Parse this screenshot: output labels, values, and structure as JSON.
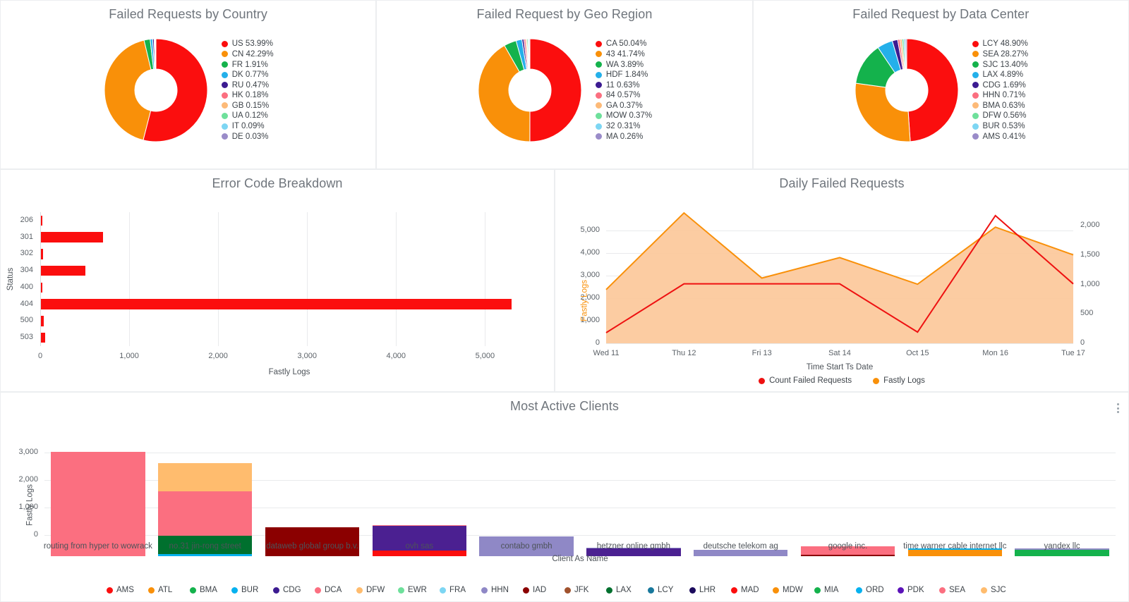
{
  "palette": {
    "red": "#fb0e0e",
    "orange": "#f99009",
    "green": "#14b24c",
    "blue": "#24b0ea",
    "darkpurple": "#3c1b91",
    "pink": "#fb6f80",
    "lightorange": "#fdba78",
    "lightgreen": "#6ee09b",
    "skyblue": "#7dd6f3",
    "lightpurple": "#9a8cc9",
    "panel_bg": "#ffffff",
    "page_bg": "#f4f5f7",
    "title_gray": "#6f757c"
  },
  "donuts": [
    {
      "title": "Failed Requests by Country",
      "slices": [
        {
          "label": "US",
          "pct": 53.99,
          "text": "US 53.99%",
          "color": "#fb0e0e"
        },
        {
          "label": "CN",
          "pct": 42.29,
          "text": "CN 42.29%",
          "color": "#f99009"
        },
        {
          "label": "FR",
          "pct": 1.91,
          "text": "FR 1.91%",
          "color": "#14b24c"
        },
        {
          "label": "DK",
          "pct": 0.77,
          "text": "DK 0.77%",
          "color": "#24b0ea"
        },
        {
          "label": "RU",
          "pct": 0.47,
          "text": "RU 0.47%",
          "color": "#3c1b91"
        },
        {
          "label": "HK",
          "pct": 0.18,
          "text": "HK 0.18%",
          "color": "#fb6f80"
        },
        {
          "label": "GB",
          "pct": 0.15,
          "text": "GB 0.15%",
          "color": "#fdba78"
        },
        {
          "label": "UA",
          "pct": 0.12,
          "text": "UA 0.12%",
          "color": "#6ee09b"
        },
        {
          "label": "IT",
          "pct": 0.09,
          "text": "IT 0.09%",
          "color": "#7dd6f3"
        },
        {
          "label": "DE",
          "pct": 0.03,
          "text": "DE 0.03%",
          "color": "#9a8cc9"
        }
      ]
    },
    {
      "title": "Failed Request by Geo Region",
      "slices": [
        {
          "label": "CA",
          "pct": 50.04,
          "text": "CA 50.04%",
          "color": "#fb0e0e"
        },
        {
          "label": "43",
          "pct": 41.74,
          "text": "43 41.74%",
          "color": "#f99009"
        },
        {
          "label": "WA",
          "pct": 3.89,
          "text": "WA 3.89%",
          "color": "#14b24c"
        },
        {
          "label": "HDF",
          "pct": 1.84,
          "text": "HDF 1.84%",
          "color": "#24b0ea"
        },
        {
          "label": "11",
          "pct": 0.63,
          "text": "11 0.63%",
          "color": "#3c1b91"
        },
        {
          "label": "84",
          "pct": 0.57,
          "text": "84 0.57%",
          "color": "#fb6f80"
        },
        {
          "label": "GA",
          "pct": 0.37,
          "text": "GA 0.37%",
          "color": "#fdba78"
        },
        {
          "label": "MOW",
          "pct": 0.37,
          "text": "MOW 0.37%",
          "color": "#6ee09b"
        },
        {
          "label": "32",
          "pct": 0.31,
          "text": "32 0.31%",
          "color": "#7dd6f3"
        },
        {
          "label": "MA",
          "pct": 0.26,
          "text": "MA 0.26%",
          "color": "#9a8cc9"
        }
      ]
    },
    {
      "title": "Failed Request by Data Center",
      "slices": [
        {
          "label": "LCY",
          "pct": 48.9,
          "text": "LCY 48.90%",
          "color": "#fb0e0e"
        },
        {
          "label": "SEA",
          "pct": 28.27,
          "text": "SEA 28.27%",
          "color": "#f99009"
        },
        {
          "label": "SJC",
          "pct": 13.4,
          "text": "SJC 13.40%",
          "color": "#14b24c"
        },
        {
          "label": "LAX",
          "pct": 4.89,
          "text": "LAX 4.89%",
          "color": "#24b0ea"
        },
        {
          "label": "CDG",
          "pct": 1.69,
          "text": "CDG 1.69%",
          "color": "#3c1b91"
        },
        {
          "label": "HHN",
          "pct": 0.71,
          "text": "HHN 0.71%",
          "color": "#fb6f80"
        },
        {
          "label": "BMA",
          "pct": 0.63,
          "text": "BMA 0.63%",
          "color": "#fdba78"
        },
        {
          "label": "DFW",
          "pct": 0.56,
          "text": "DFW 0.56%",
          "color": "#6ee09b"
        },
        {
          "label": "BUR",
          "pct": 0.53,
          "text": "BUR 0.53%",
          "color": "#7dd6f3"
        },
        {
          "label": "AMS",
          "pct": 0.41,
          "text": "AMS 0.41%",
          "color": "#9a8cc9"
        }
      ]
    }
  ],
  "error_chart": {
    "title": "Error Code Breakdown"
  },
  "daily_chart": {
    "title": "Daily Failed Requests"
  },
  "clients_chart": {
    "title": "Most Active Clients"
  },
  "chart_data": [
    {
      "type": "bar",
      "orientation": "horizontal",
      "title": "Error Code Breakdown",
      "xlabel": "Fastly Logs",
      "ylabel": "Status",
      "categories": [
        "206",
        "301",
        "302",
        "304",
        "400",
        "404",
        "500",
        "503"
      ],
      "values": [
        8,
        700,
        25,
        500,
        5,
        5290,
        35,
        50
      ],
      "xlim": [
        0,
        5600
      ],
      "xticks": [
        0,
        1000,
        2000,
        3000,
        4000,
        5000
      ],
      "xticklabels": [
        "0",
        "1,000",
        "2,000",
        "3,000",
        "4,000",
        "5,000"
      ],
      "color": "#fb0e0e",
      "grid": true
    },
    {
      "type": "area",
      "title": "Daily Failed Requests",
      "xlabel": "Time Start Ts Date",
      "ylabel": "Fastly Logs",
      "y2label": "Count Failed Requests",
      "categories": [
        "Wed 11",
        "Thu 12",
        "Fri 13",
        "Sat 14",
        "Oct 15",
        "Mon 16",
        "Tue 17"
      ],
      "ylim": [
        0,
        6000
      ],
      "yticks": [
        0,
        1000,
        2000,
        3000,
        4000,
        5000
      ],
      "yticklabels": [
        "0",
        "1,000",
        "2,000",
        "3,000",
        "4,000",
        "5,000"
      ],
      "y2lim": [
        0,
        2300
      ],
      "y2ticks": [
        0,
        500,
        1000,
        1500,
        2000
      ],
      "y2ticklabels": [
        "0",
        "500",
        "1,000",
        "1,500",
        "2,000"
      ],
      "series": [
        {
          "name": "Fastly Logs",
          "axis": "left",
          "kind": "area",
          "color": "#f99009",
          "fill": "#fcc89a",
          "values": [
            2380,
            5780,
            2890,
            3800,
            2620,
            5150,
            3920
          ]
        },
        {
          "name": "Count Failed Requests",
          "axis": "right",
          "kind": "line",
          "color": "#ee1111",
          "values": [
            180,
            1010,
            1010,
            1010,
            190,
            2170,
            1010
          ]
        }
      ],
      "legend": [
        "Count Failed Requests",
        "Fastly Logs"
      ],
      "legend_position": "bottom"
    },
    {
      "type": "bar",
      "stacked": true,
      "title": "Most Active Clients",
      "xlabel": "Client As Name",
      "ylabel": "Fastly Logs",
      "ylim": [
        0,
        4000
      ],
      "yticks": [
        0,
        1000,
        2000,
        3000
      ],
      "yticklabels": [
        "0",
        "1,000",
        "2,000",
        "3,000"
      ],
      "categories": [
        "routing from hyper to wowrack",
        "no.31 jin-rong street",
        "dataweb global group b.v.",
        "ovh sas",
        "contabo gmbh",
        "hetzner online gmbh",
        "deutsche telekom ag",
        "google inc.",
        "time warner cable internet llc",
        "yandex llc"
      ],
      "stacks": [
        [
          {
            "name": "DCA",
            "value": 3790,
            "color": "#fb6f80"
          }
        ],
        [
          {
            "name": "BUR",
            "value": 90,
            "color": "#06b1ef"
          },
          {
            "name": "LAX",
            "value": 650,
            "color": "#00702e"
          },
          {
            "name": "DCA",
            "value": 1620,
            "color": "#fb6f80"
          },
          {
            "name": "DFW",
            "value": 1030,
            "color": "#ffbc6e"
          }
        ],
        [
          {
            "name": "IAD",
            "value": 1040,
            "color": "#8b0000"
          }
        ],
        [
          {
            "name": "MAD",
            "value": 210,
            "color": "#fb0e0e"
          },
          {
            "name": "CDG",
            "value": 900,
            "color": "#4b2091"
          },
          {
            "name": "SEA",
            "value": 30,
            "color": "#fb6f80"
          }
        ],
        [
          {
            "name": "HHN",
            "value": 720,
            "color": "#8f88c6"
          }
        ],
        [
          {
            "name": "CDG",
            "value": 270,
            "color": "#4b2091"
          },
          {
            "name": "HHN",
            "value": 40,
            "color": "#8f88c6"
          }
        ],
        [
          {
            "name": "HHN",
            "value": 240,
            "color": "#8f88c6"
          }
        ],
        [
          {
            "name": "IAD",
            "value": 60,
            "color": "#8b0000"
          },
          {
            "name": "DCA",
            "value": 290,
            "color": "#fb6f80"
          }
        ],
        [
          {
            "name": "MDW",
            "value": 220,
            "color": "#f99009"
          },
          {
            "name": "ORD",
            "value": 60,
            "color": "#06b1ef"
          }
        ],
        [
          {
            "name": "MIA",
            "value": 230,
            "color": "#14b24c"
          },
          {
            "name": "HHN",
            "value": 50,
            "color": "#8f88c6"
          }
        ]
      ],
      "legend": [
        {
          "label": "AMS",
          "color": "#fb0e0e"
        },
        {
          "label": "ATL",
          "color": "#f99009"
        },
        {
          "label": "BMA",
          "color": "#14b24c"
        },
        {
          "label": "BUR",
          "color": "#06b1ef"
        },
        {
          "label": "CDG",
          "color": "#3c1b91"
        },
        {
          "label": "DCA",
          "color": "#fb6f80"
        },
        {
          "label": "DFW",
          "color": "#ffbc6e"
        },
        {
          "label": "EWR",
          "color": "#6ee09b"
        },
        {
          "label": "FRA",
          "color": "#7dd6f3"
        },
        {
          "label": "HHN",
          "color": "#8f88c6"
        },
        {
          "label": "IAD",
          "color": "#8b0000"
        },
        {
          "label": "JFK",
          "color": "#a0522d"
        },
        {
          "label": "LAX",
          "color": "#00702e"
        },
        {
          "label": "LCY",
          "color": "#18789c"
        },
        {
          "label": "LHR",
          "color": "#1b0a5c"
        },
        {
          "label": "MAD",
          "color": "#fb0e0e"
        },
        {
          "label": "MDW",
          "color": "#f99009"
        },
        {
          "label": "MIA",
          "color": "#14b24c"
        },
        {
          "label": "ORD",
          "color": "#06b1ef"
        },
        {
          "label": "PDK",
          "color": "#5b12b8"
        },
        {
          "label": "SEA",
          "color": "#fb6f80"
        },
        {
          "label": "SJC",
          "color": "#ffbc6e"
        }
      ],
      "legend_position": "bottom"
    }
  ]
}
